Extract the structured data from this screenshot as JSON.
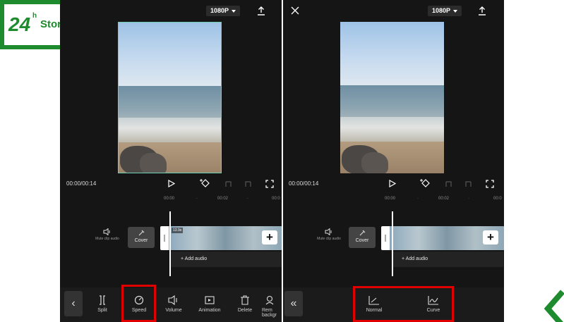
{
  "logo": {
    "number": "24",
    "superscript": "h",
    "name": "Store.vn",
    "reg": "®",
    "color": "#1e8b2e"
  },
  "left_panel": {
    "resolution": "1080P",
    "time": "00:00/00:14",
    "ruler": [
      "00:00",
      "·",
      "00:02",
      "·",
      "00:0"
    ],
    "clip_badge": "13.9s",
    "mute_label": "Mute clip audio",
    "cover_label": "Cover",
    "add_audio": "+ Add audio",
    "tools": [
      {
        "label": "Split",
        "icon": "split-icon"
      },
      {
        "label": "Speed",
        "icon": "speed-icon"
      },
      {
        "label": "Volume",
        "icon": "volume-icon"
      },
      {
        "label": "Animation",
        "icon": "animation-icon"
      },
      {
        "label": "Delete",
        "icon": "delete-icon"
      },
      {
        "label": "Rem backgr",
        "icon": "remove-background-icon"
      }
    ]
  },
  "right_panel": {
    "resolution": "1080P",
    "time": "00:00/00:14",
    "ruler": [
      "00:00",
      "·",
      "00:02",
      "·",
      "00:0"
    ],
    "mute_label": "Mute clip audio",
    "cover_label": "Cover",
    "add_audio": "+ Add audio",
    "speed_options": [
      {
        "label": "Normal",
        "icon": "normal-speed-icon"
      },
      {
        "label": "Curve",
        "icon": "curve-speed-icon"
      }
    ]
  },
  "highlight_color": "#e10000"
}
